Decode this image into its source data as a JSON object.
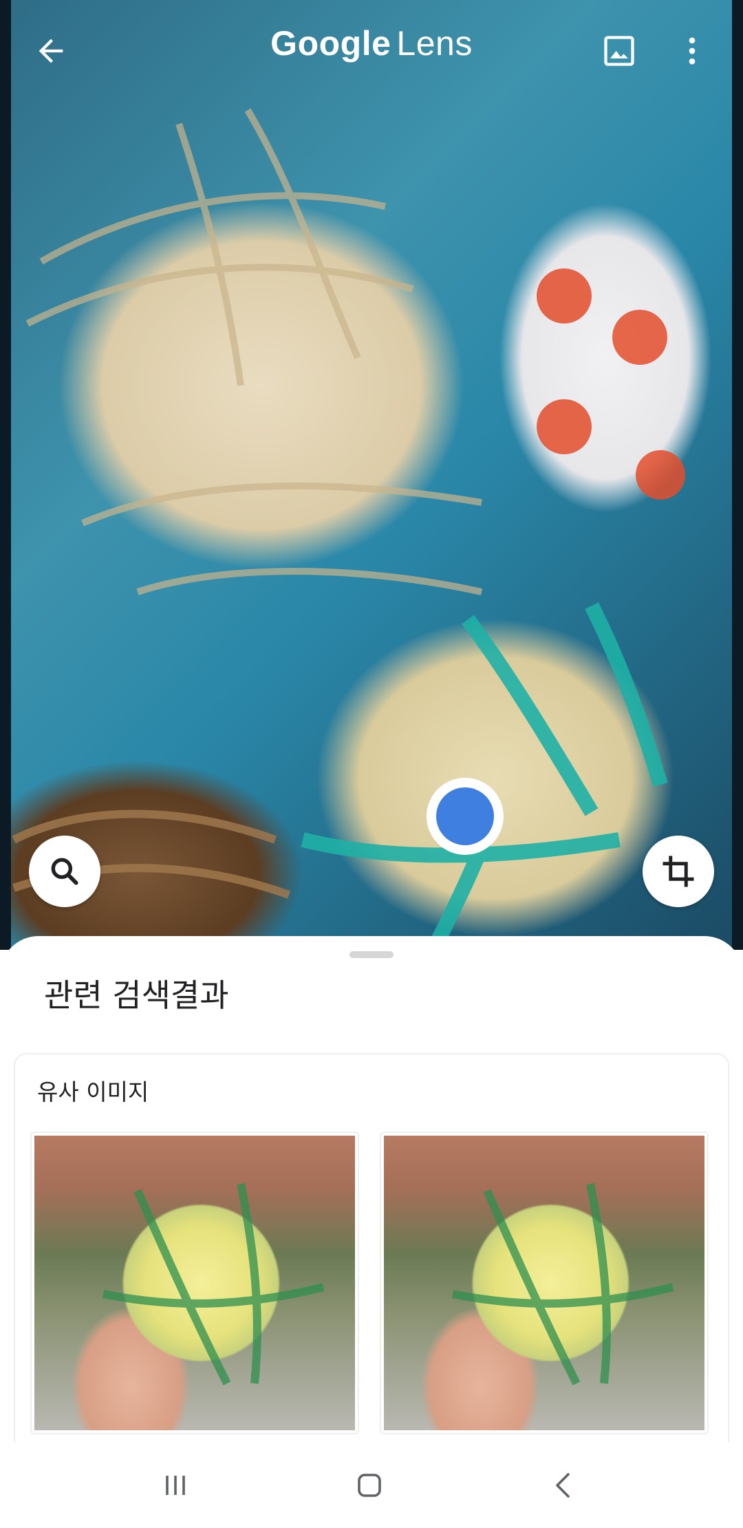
{
  "app": {
    "title_part1": "Google",
    "title_part2": "Lens"
  },
  "toolbar": {
    "back_icon": "arrow-left-icon",
    "gallery_icon": "image-icon",
    "more_icon": "more-vert-icon"
  },
  "camera": {
    "search_icon": "search-icon",
    "crop_icon": "crop-icon",
    "shutter_color": "#3f7fe0"
  },
  "sheet": {
    "title": "관련 검색결과",
    "card_title": "유사 이미지"
  },
  "navbar": {
    "recent_icon": "recent-apps-icon",
    "home_icon": "home-icon",
    "back_icon": "back-icon"
  }
}
